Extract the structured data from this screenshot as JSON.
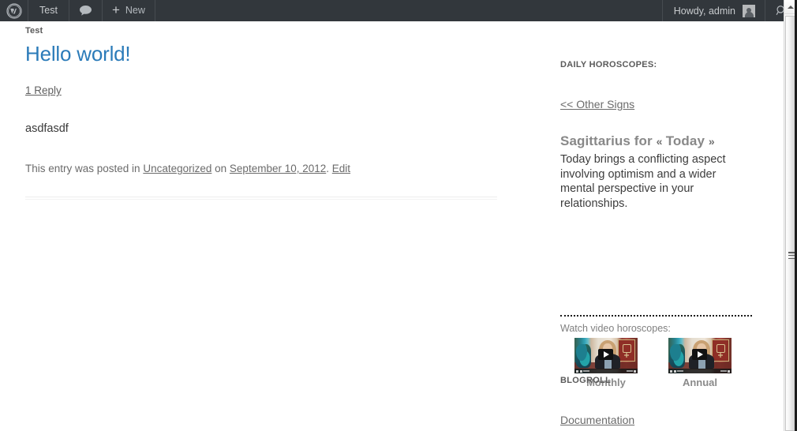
{
  "admin_bar": {
    "logo_icon": "wordpress-logo-icon",
    "site_name": "Test",
    "comments_icon": "comment-bubble-icon",
    "new_label": "New",
    "new_icon": "plus-icon",
    "howdy": "Howdy, admin",
    "avatar_icon": "user-avatar-icon",
    "search_icon": "search-icon"
  },
  "content": {
    "site_title": "Test",
    "post_title": "Hello world!",
    "reply_link": "1 Reply",
    "body_text": "asdfasdf",
    "meta_prefix": "This entry was posted in ",
    "meta_category": "Uncategorized",
    "meta_on": " on ",
    "meta_date": "September 10, 2012",
    "meta_period": ". ",
    "meta_edit": "Edit"
  },
  "sidebar": {
    "horoscopes": {
      "title": "DAILY HOROSCOPES:",
      "other_signs_link": "<< Other Signs",
      "sign_name": "Sagittarius for",
      "prev_arrow": "«",
      "today_label": "Today",
      "next_arrow": "»",
      "reading": "Today brings a conflicting aspect involving optimism and a wider mental perspective in your relationships.",
      "video_label": "Watch video horoscopes:",
      "videos": [
        {
          "caption": "Monthly",
          "thumb_icon": "video-thumbnail-play-icon"
        },
        {
          "caption": "Annual",
          "thumb_icon": "video-thumbnail-play-icon"
        }
      ]
    },
    "blogroll": {
      "title": "BLOGROLL",
      "links": [
        {
          "label": "Documentation"
        }
      ]
    }
  },
  "scrollbar": {
    "up_arrow_icon": "scroll-up-arrow-icon",
    "grip_icon": "scrollbar-grip-icon"
  },
  "colors": {
    "adminbar_bg": "#32373c",
    "title_link": "#2b7bb9",
    "body_text": "#3a3a3a",
    "muted_text": "#6b6b6b",
    "heading_gray": "#888888"
  }
}
